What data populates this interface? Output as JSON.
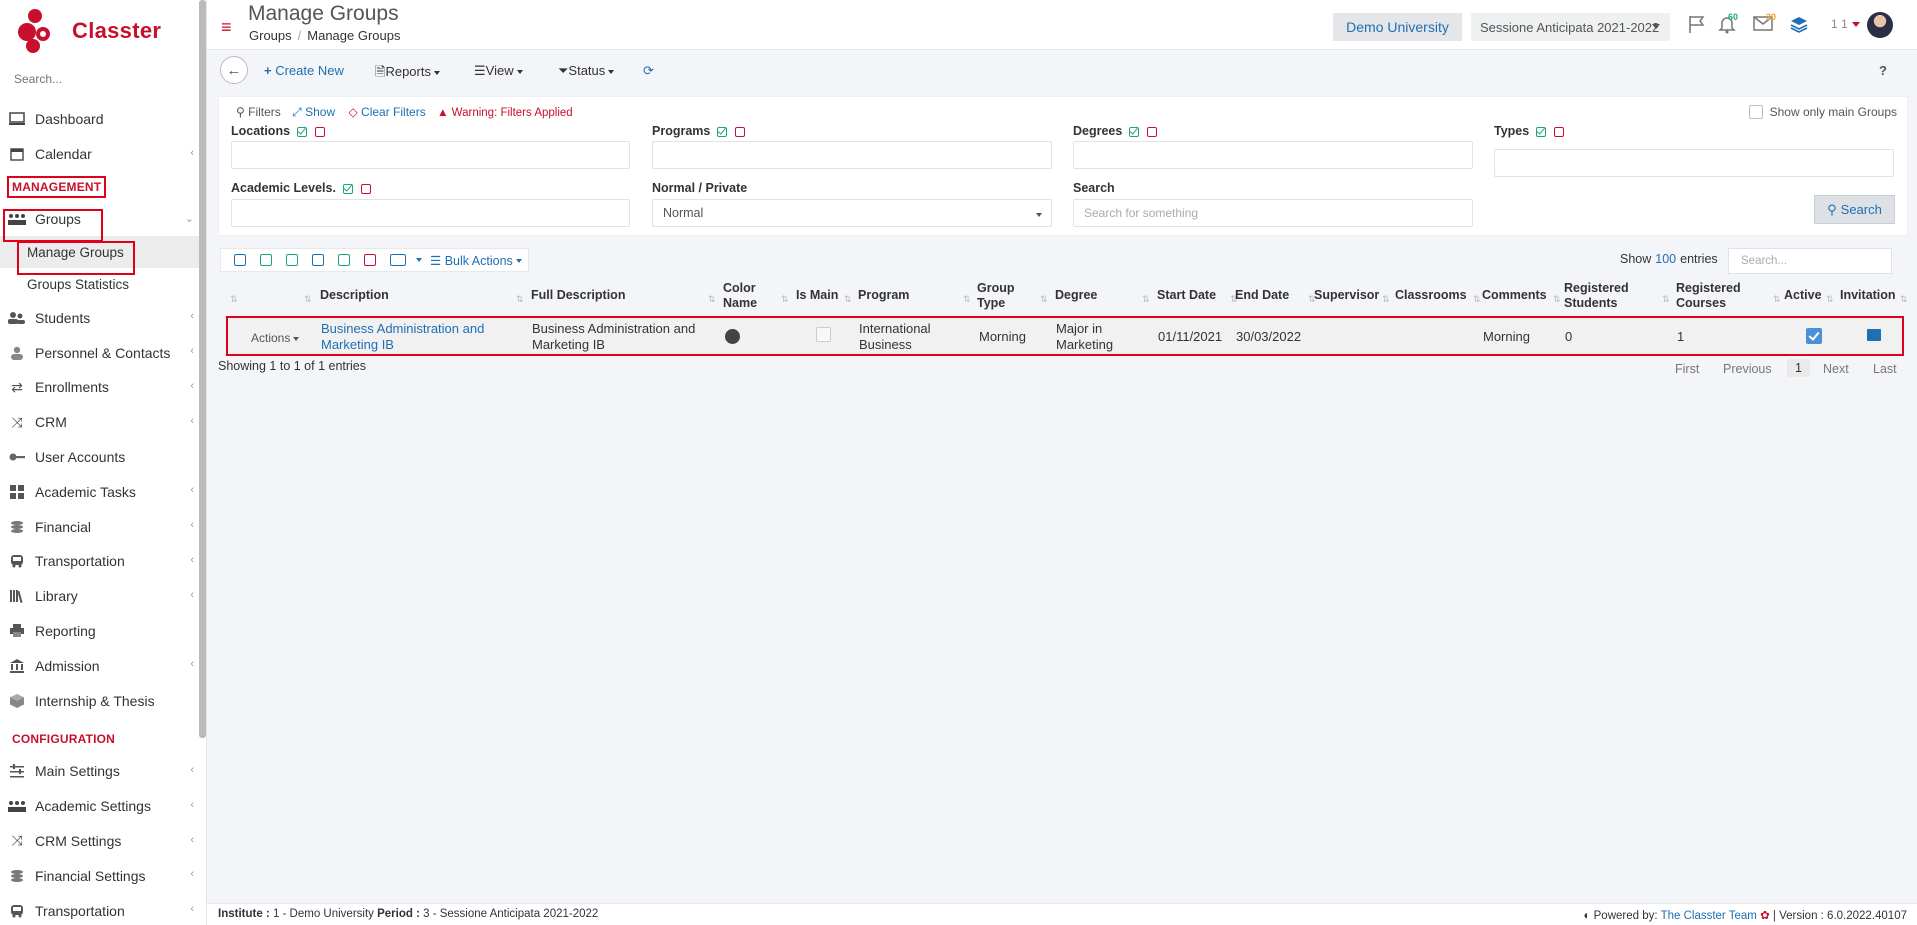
{
  "brand": {
    "name": "Classter"
  },
  "sidebar": {
    "search_placeholder": "Search...",
    "items_top": [
      {
        "label": "Dashboard",
        "icon": "monitor-icon"
      },
      {
        "label": "Calendar",
        "icon": "calendar-icon"
      }
    ],
    "management_title": "MANAGEMENT",
    "groups_label": "Groups",
    "groups_sub": [
      {
        "label": "Manage Groups"
      },
      {
        "label": "Groups Statistics"
      }
    ],
    "items_mid": [
      {
        "label": "Students",
        "icon": "students-icon"
      },
      {
        "label": "Personnel & Contacts",
        "icon": "contacts-icon"
      },
      {
        "label": "Enrollments",
        "icon": "exchange-icon"
      },
      {
        "label": "CRM",
        "icon": "crm-icon"
      },
      {
        "label": "User Accounts",
        "icon": "key-icon"
      },
      {
        "label": "Academic Tasks",
        "icon": "grid-icon"
      },
      {
        "label": "Financial",
        "icon": "coins-icon"
      },
      {
        "label": "Transportation",
        "icon": "bus-icon"
      },
      {
        "label": "Library",
        "icon": "books-icon"
      },
      {
        "label": "Reporting",
        "icon": "printer-icon"
      },
      {
        "label": "Admission",
        "icon": "bank-icon"
      },
      {
        "label": "Internship & Thesis",
        "icon": "cube-icon"
      }
    ],
    "configuration_title": "CONFIGURATION",
    "items_config": [
      {
        "label": "Main Settings",
        "icon": "sliders-icon"
      },
      {
        "label": "Academic Settings",
        "icon": "group-icon"
      },
      {
        "label": "CRM Settings",
        "icon": "crm-icon"
      },
      {
        "label": "Financial Settings",
        "icon": "coins-icon"
      },
      {
        "label": "Transportation",
        "icon": "bus-icon"
      }
    ]
  },
  "header": {
    "title": "Manage Groups",
    "breadcrumb": [
      "Groups",
      "Manage Groups"
    ],
    "university": "Demo University",
    "session": "Sessione Anticipata 2021-2022",
    "badge_notifications": "60",
    "badge_messages": "30",
    "user_num": "1 1"
  },
  "toolbar": {
    "create_new": "Create New",
    "reports": "Reports",
    "view": "View",
    "status": "Status",
    "help": "?"
  },
  "filters": {
    "title": "Filters",
    "show": "Show",
    "clear": "Clear Filters",
    "warning": "Warning: Filters Applied",
    "locations": "Locations",
    "programs": "Programs",
    "degrees": "Degrees",
    "types": "Types",
    "show_only_main": "Show only main Groups",
    "academic_levels": "Academic Levels.",
    "normal_private": "Normal / Private",
    "normal_private_value": "Normal",
    "search": "Search",
    "search_placeholder": "Search for something",
    "search_button": "Search"
  },
  "table": {
    "bulk_actions": "Bulk Actions",
    "show": "Show",
    "entries_count": "100",
    "entries": "entries",
    "search_placeholder": "Search...",
    "columns": {
      "description": "Description",
      "full_description": "Full Description",
      "color_name_1": "Color",
      "color_name_2": "Name",
      "is_main": "Is Main",
      "program": "Program",
      "group_type_1": "Group",
      "group_type_2": "Type",
      "degree": "Degree",
      "start_date": "Start Date",
      "end_date": "End Date",
      "supervisor": "Supervisor",
      "classrooms": "Classrooms",
      "comments": "Comments",
      "reg_students_1": "Registered",
      "reg_students_2": "Students",
      "reg_courses_1": "Registered",
      "reg_courses_2": "Courses",
      "active": "Active",
      "invitation": "Invitation"
    },
    "row": {
      "actions": "Actions",
      "description_1": "Business Administration and",
      "description_2": "Marketing IB",
      "full_description_1": "Business Administration and",
      "full_description_2": "Marketing IB",
      "program_1": "International",
      "program_2": "Business",
      "group_type": "Morning",
      "degree_1": "Major in",
      "degree_2": "Marketing",
      "start_date": "01/11/2021",
      "end_date": "30/03/2022",
      "comments": "Morning",
      "registered_students": "0",
      "registered_courses": "1"
    },
    "showing": "Showing 1 to 1 of 1 entries",
    "pager": {
      "first": "First",
      "previous": "Previous",
      "current": "1",
      "next": "Next",
      "last": "Last"
    }
  },
  "footer": {
    "institute_label": "Institute :",
    "institute_value": " 1 - Demo University ",
    "period_label": "Period :",
    "period_value": " 3 - Sessione Anticipata 2021-2022",
    "powered_by": "Powered by:",
    "team": "The Classter Team",
    "version": "| Version : 6.0.2022.40107"
  },
  "colors": {
    "brand_red": "#c8102e",
    "link_blue": "#1f6fb5",
    "highlight_red": "#e0001b"
  }
}
